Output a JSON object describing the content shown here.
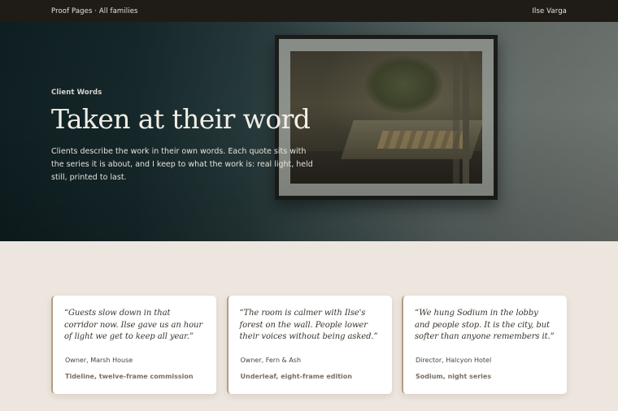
{
  "nav": {
    "brand": "Proof Pages · All families",
    "user": "Ilse Varga"
  },
  "hero": {
    "eyebrow": "Client Words",
    "title": "Taken at their word",
    "body": "Clients describe the work in their own words. Each quote sits with the series it is about, and I keep to what the work is: real light, held still, printed to last."
  },
  "testimonials": [
    {
      "quote": "“Guests slow down in that corridor now. Ilse gave us an hour of light we get to keep all year.”",
      "author": "Owner, Marsh House",
      "series": "Tideline, twelve-frame commission"
    },
    {
      "quote": "“The room is calmer with Ilse's forest on the wall. People lower their voices without being asked.”",
      "author": "Owner, Fern & Ash",
      "series": "Underleaf, eight-frame edition"
    },
    {
      "quote": "“We hung Sodium in the lobby and people stop. It is the city, but softer than anyone remembers it.”",
      "author": "Director, Halcyon Hotel",
      "series": "Sodium, night series"
    }
  ]
}
